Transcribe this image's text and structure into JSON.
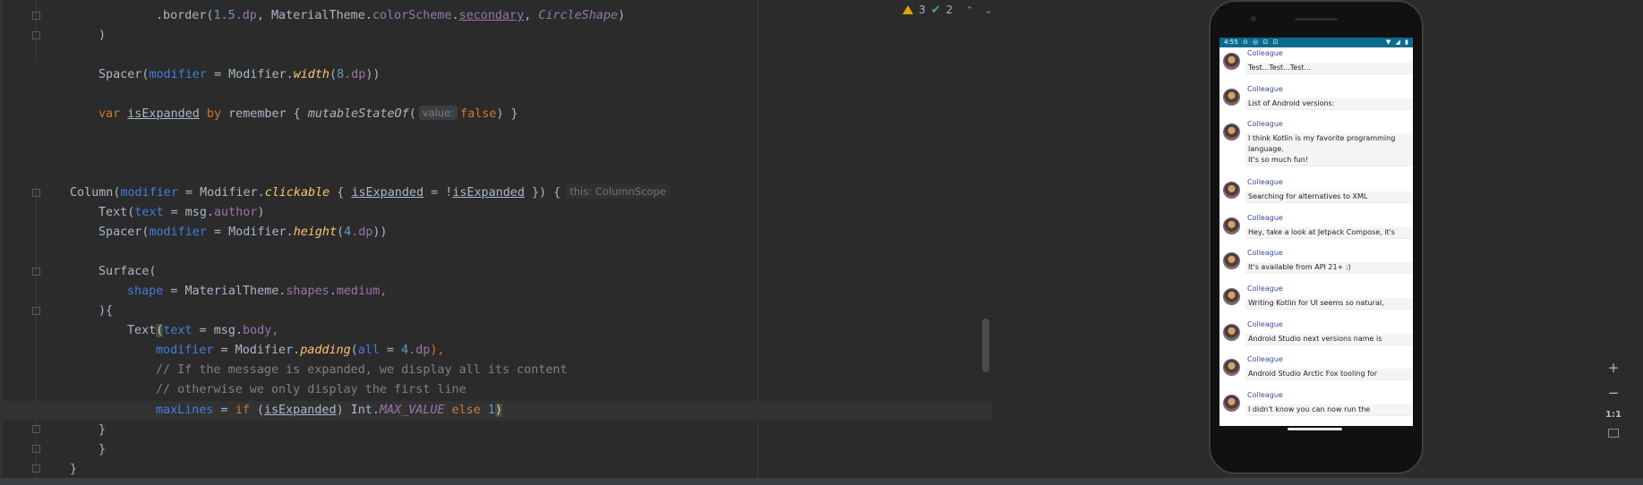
{
  "inspections": {
    "warnings": "3",
    "weak_warnings": "2"
  },
  "code": {
    "line_border": {
      "prefix": ".border(",
      "n1": "1.5",
      "dp1": ".dp",
      "c1": ", MaterialTheme.",
      "cs": "colorScheme",
      "dot": ".",
      "sec": "secondary",
      "c2": ", ",
      "circ": "CircleShape",
      "end": ")"
    },
    "line_close1": ")",
    "line_spacer": {
      "a": "Spacer(",
      "b": "modifier",
      "c": " = Modifier.",
      "d": "width",
      "e": "(",
      "f": "8",
      "g": ".dp",
      "h": "))"
    },
    "line_var": {
      "a": "var ",
      "b": "isExpanded",
      "c": " by ",
      "d": "remember",
      "e": " { ",
      "f": "mutableStateOf",
      "g": "(",
      "hint": "value:",
      "h": "false",
      "i": ") }"
    },
    "line_column": {
      "a": "Column(",
      "b": "modifier",
      "c": " = Modifier.",
      "d": "clickable",
      "e": " { ",
      "f": "isExpanded",
      "g": " = !",
      "h": "isExpanded",
      "i": " }) {",
      "hint": "this: ColumnScope"
    },
    "line_text1": {
      "a": "Text(",
      "b": "text",
      "c": " = msg.",
      "d": "author",
      "e": ")"
    },
    "line_spacer2": {
      "a": "Spacer(",
      "b": "modifier",
      "c": " = Modifier.",
      "d": "height",
      "e": "(",
      "f": "4",
      "g": ".dp",
      "h": "))"
    },
    "line_surface": "Surface(",
    "line_shape": {
      "a": "shape",
      "b": " = MaterialTheme.",
      "c": "shapes",
      "d": ".",
      "e": "medium",
      "f": ","
    },
    "line_brace": "){",
    "line_text2": {
      "a": "Text",
      "b": "(",
      "c": "text",
      "d": " = msg.",
      "e": "body",
      "f": ","
    },
    "line_mod": {
      "a": "modifier",
      "b": " = Modifier.",
      "c": "padding",
      "d": "(",
      "e": "all",
      "f": " = ",
      "g": "4",
      "h": ".dp",
      "i": "),"
    },
    "comment1": "// If the message is expanded, we display all its content",
    "comment2": "// otherwise we only display the first line",
    "line_max": {
      "a": "maxLines",
      "b": " = ",
      "c": "if",
      "d": " (",
      "e": "isExpanded",
      "f": ") Int.",
      "g": "MAX_VALUE",
      "h": " else ",
      "i": "1",
      "j": ")"
    },
    "close_a": "}",
    "close_b": "}",
    "close_c": "}"
  },
  "status_bar": {
    "time": "4:55",
    "icons_left": [
      "⊙",
      "◎",
      "⊡",
      "⊡"
    ],
    "icons_right": [
      "▼",
      "◢",
      "▮"
    ]
  },
  "messages": [
    {
      "author": "Colleague",
      "body": "Test...Test...Test..."
    },
    {
      "author": "Colleague",
      "body": "List of Android versions:"
    },
    {
      "author": "Colleague",
      "body_lines": [
        "I think Kotlin is my favorite programming",
        "language.",
        "It's so much fun!"
      ]
    },
    {
      "author": "Colleague",
      "body": "Searching for alternatives to XML"
    },
    {
      "author": "Colleague",
      "body": "Hey, take a look at Jetpack Compose, it's"
    },
    {
      "author": "Colleague",
      "body": "It's available from API 21+ :)"
    },
    {
      "author": "Colleague",
      "body": "Writing Kotlin for UI seems so natural,"
    },
    {
      "author": "Colleague",
      "body": "Android Studio next versions name is"
    },
    {
      "author": "Colleague",
      "body": "Android Studio Arctic Fox tooling for"
    },
    {
      "author": "Colleague",
      "body": "I didn't know you can now run the"
    }
  ],
  "zoom": {
    "in": "+",
    "out": "−",
    "reset": "1:1"
  }
}
